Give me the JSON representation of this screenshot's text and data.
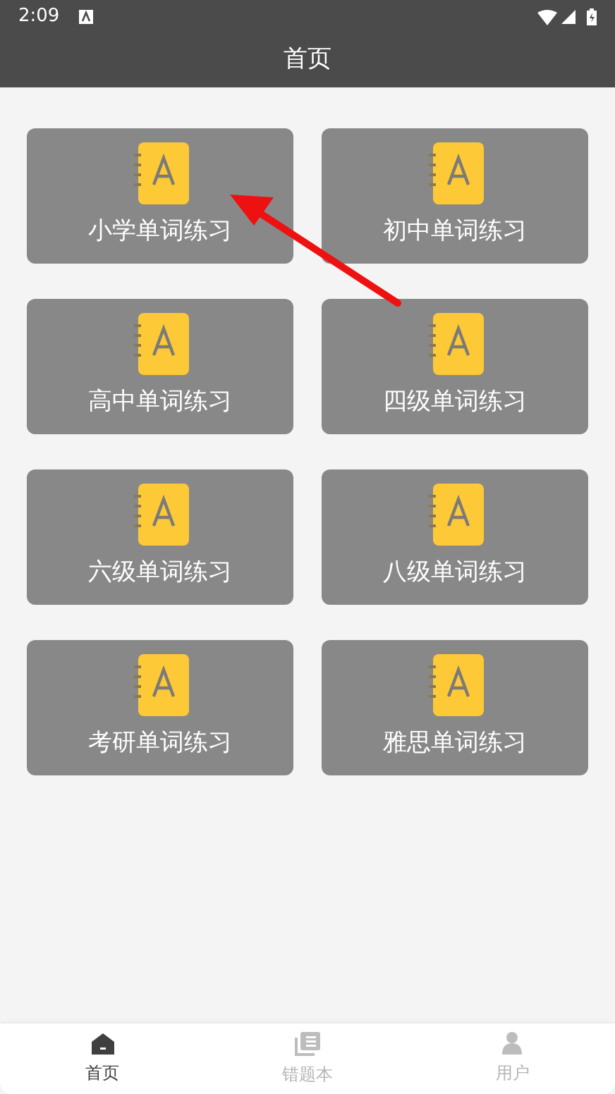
{
  "status_bar": {
    "time": "2:09"
  },
  "title_bar": {
    "title": "首页"
  },
  "cards": [
    {
      "label": "小学单词练习"
    },
    {
      "label": "初中单词练习"
    },
    {
      "label": "高中单词练习"
    },
    {
      "label": "四级单词练习"
    },
    {
      "label": "六级单词练习"
    },
    {
      "label": "八级单词练习"
    },
    {
      "label": "考研单词练习"
    },
    {
      "label": "雅思单词练习"
    }
  ],
  "bottom_nav": [
    {
      "label": "首页",
      "kind": "home",
      "selected": true
    },
    {
      "label": "错题本",
      "kind": "book",
      "selected": false
    },
    {
      "label": "用户",
      "kind": "user",
      "selected": false
    }
  ]
}
